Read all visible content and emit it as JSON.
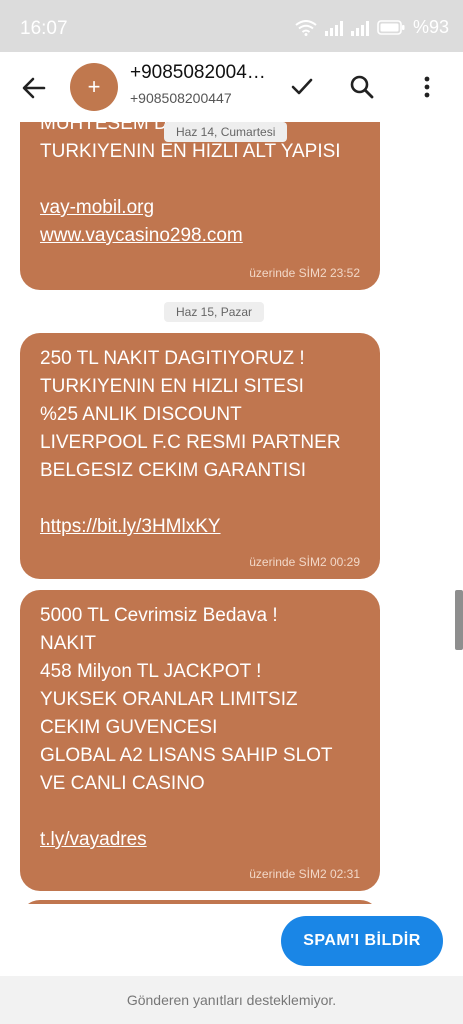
{
  "status": {
    "time": "16:07",
    "battery": "%93"
  },
  "header": {
    "avatar_symbol": "+",
    "title": "+9085082004…",
    "subtitle": "+908508200447"
  },
  "chat": {
    "top_date": "Haz 14, Cumartesi",
    "partial_message": {
      "lines": [
        "MUHTESEM D...",
        "TURKIYENIN EN HIZLI ALT YAPISI",
        "",
        "vay-mobil.org",
        "www.vaycasino298.com"
      ],
      "meta": "üzerinde SİM2  23:52"
    },
    "date_2": "Haz 15, Pazar",
    "message_1": {
      "lines": [
        "250 TL NAKIT DAGITIYORUZ !",
        "TURKIYENIN EN HIZLI SITESI",
        "%25 ANLIK DISCOUNT",
        "LIVERPOOL F.C RESMI PARTNER",
        "BELGESIZ CEKIM GARANTISI",
        "",
        "https://bit.ly/3HMlxKY"
      ],
      "meta": "üzerinde SİM2  00:29"
    },
    "message_2": {
      "lines": [
        "5000 TL Cevrimsiz Bedava !",
        "NAKIT",
        "458 Milyon TL JACKPOT !",
        "YUKSEK ORANLAR LIMITSIZ",
        "CEKIM GUVENCESI",
        "GLOBAL A2 LISANS SAHIP SLOT",
        "VE CANLI CASINO",
        "",
        "t.ly/vayadres"
      ],
      "meta": "üzerinde SİM2  02:31"
    }
  },
  "spam_button": "SPAM'I BİLDİR",
  "footer_text": "Gönderen yanıtları desteklemiyor.",
  "colors": {
    "bubble": "#c0764f",
    "accent": "#1a86e6",
    "avatar": "#c0784e"
  }
}
